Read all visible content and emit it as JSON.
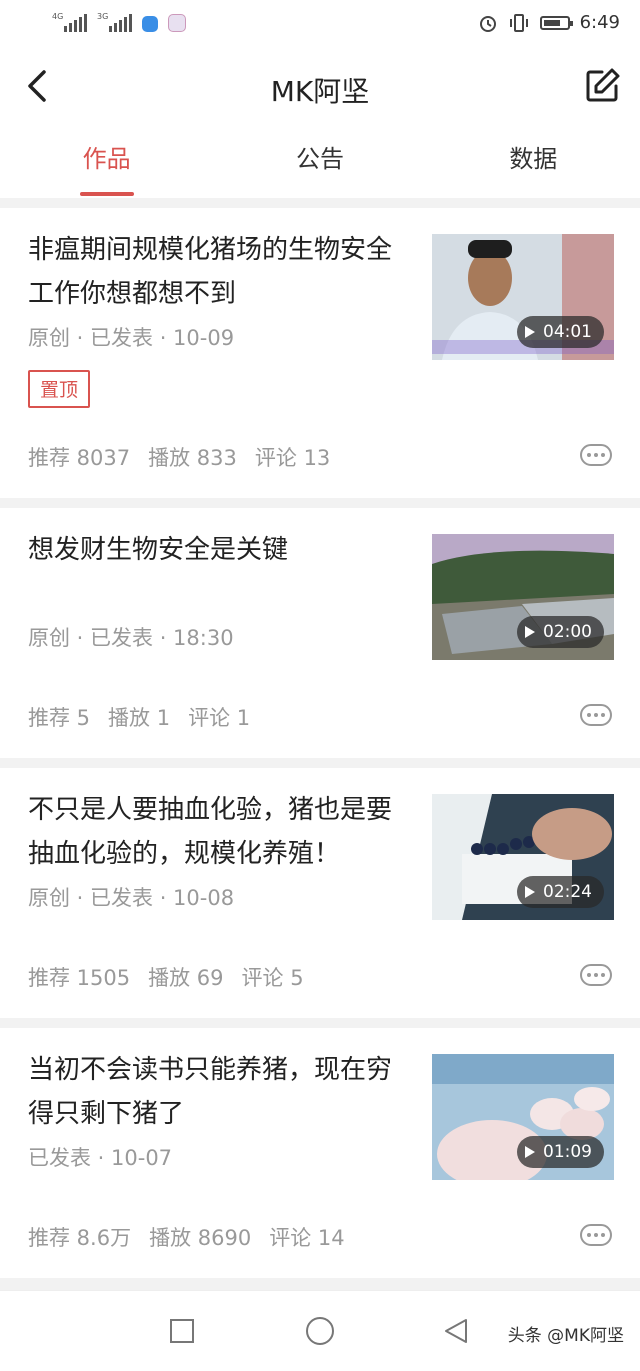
{
  "status_bar": {
    "sim1": "4G",
    "sim2": "3G",
    "time": "6:49"
  },
  "header": {
    "title": "MK阿坚"
  },
  "tabs": [
    {
      "label": "作品",
      "active": true
    },
    {
      "label": "公告",
      "active": false
    },
    {
      "label": "数据",
      "active": false
    }
  ],
  "articles": [
    {
      "title": "非瘟期间规模化猪场的生物安全工作你想都想不到",
      "meta": "原创 · 已发表 · 10-09",
      "pin": "置顶",
      "duration": "04:01",
      "stats": {
        "recommend": "推荐 8037",
        "play": "播放 833",
        "comment": "评论 13"
      }
    },
    {
      "title": "想发财生物安全是关键",
      "meta": "原创 · 已发表 · 18:30",
      "duration": "02:00",
      "stats": {
        "recommend": "推荐 5",
        "play": "播放 1",
        "comment": "评论 1"
      }
    },
    {
      "title": "不只是人要抽血化验，猪也是要抽血化验的，规模化养殖！",
      "meta": "原创 · 已发表 · 10-08",
      "duration": "02:24",
      "stats": {
        "recommend": "推荐 1505",
        "play": "播放 69",
        "comment": "评论 5"
      }
    },
    {
      "title": "当初不会读书只能养猪，现在穷得只剩下猪了",
      "meta": "已发表 · 10-07",
      "duration": "01:09",
      "stats": {
        "recommend": "推荐 8.6万",
        "play": "播放 8690",
        "comment": "评论 14"
      }
    }
  ],
  "watermark": "头条 @MK阿坚",
  "colors": {
    "accent": "#d9534f"
  }
}
